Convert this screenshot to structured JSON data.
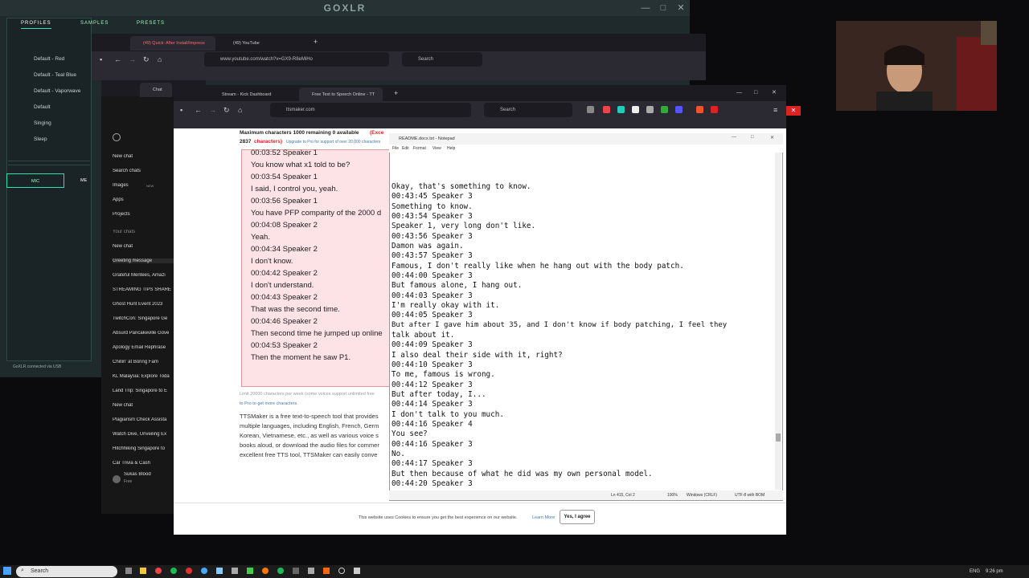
{
  "goxlr": {
    "title": "GOXLR",
    "tabs": [
      "PROFILES",
      "SAMPLES",
      "PRESETS"
    ],
    "profiles": [
      "Default - Red",
      "Default - Teal Blue",
      "Default - Vaporwave",
      "Default",
      "Singing",
      "Sleep"
    ],
    "bottom_tabs": [
      "MIC",
      "ME"
    ],
    "status": "GoXLR connected via USB",
    "accent_color": "#2ee0b0"
  },
  "browser1": {
    "tabs": [
      "(49) Quick: After Install/Impress",
      "(49) YouTube"
    ],
    "url": "www.youtube.com/watch?v=GX9-R8eMiHo",
    "search_placeholder": "Search"
  },
  "chat": {
    "tab_label": "Chat",
    "menu": [
      "New chat",
      "Search chats",
      "Images",
      "Apps",
      "Projects"
    ],
    "images_badge": "NEW",
    "section": "Your chats",
    "items": [
      "New chat",
      "Greeting message",
      "Grateful Mentees, Amazi",
      "STREAMING TIPS SHARE",
      "Ghost Hunt Event 2023",
      "TwitchCon: Singapore Ge",
      "Absurd Pancakeville Gove",
      "Apology Email Rephrase",
      "Chillin' at Boring Fam",
      "KL Malaysia: Explore Toda",
      "Land Trip: Singapore to E",
      "New chat",
      "Plagiarism Check Assista",
      "Watch Dive, Unveiling Ex",
      "Hitchhiking Singapore to",
      "Car Trivia & Cash"
    ],
    "user_name": "Sukas Blood",
    "user_plan": "Free"
  },
  "browser3": {
    "tabs": [
      "Stream - Kick Dashboard",
      "Free Text to Speech Online - TT"
    ],
    "url": "ttsmaker.com",
    "search_placeholder": "Search"
  },
  "tts": {
    "char_info": "Maximum characters 1000 remaining 0 available",
    "char_info_extra": "(Exce",
    "char_count": "2837",
    "char_count_suffix": "characters)",
    "upgrade_note": "Upgrade to Pro for support of over 20,000 characters",
    "lines": [
      "00:03:52 Speaker 1",
      "You know what x1 told to be?",
      "00:03:54 Speaker 1",
      "I said, I control you, yeah.",
      "00:03:56 Speaker 1",
      "You have PFP comparity of the 2000 d",
      "00:04:08 Speaker 2",
      "Yeah.",
      "00:04:34 Speaker 2",
      "I don't know.",
      "00:04:42 Speaker 2",
      "I don't understand.",
      "00:04:43 Speaker 2",
      "That was the second time.",
      "00:04:46 Speaker 2",
      "Then second time he jumped up online",
      "00:04:53 Speaker 2",
      "Then the moment he saw P1."
    ],
    "limit_note": "Limit 20000 characters per week (some voices support unlimited free",
    "pro_link": "to Pro to get more characters.",
    "description": [
      "TTSMaker is a free text-to-speech tool that provides",
      "multiple languages, including English, French, Germ",
      "Korean, Vietnamese, etc., as well as various voice s",
      "books aloud, or download the audio files for commer",
      "excellent free TTS tool, TTSMaker can easily conve"
    ],
    "cookie_text": "This website uses Cookies to ensure you get the best experience on our website.",
    "cookie_link": "Learn More",
    "cookie_button": "Yes, I agree"
  },
  "notepad": {
    "title": "README.docx.txt - Notepad",
    "menu": [
      "File",
      "Edit",
      "Format",
      "View",
      "Help"
    ],
    "lines": [
      "",
      "Okay, that's something to know.",
      "00:43:45 Speaker 3",
      "Something to know.",
      "00:43:54 Speaker 3",
      "Speaker 1, very long don't like.",
      "00:43:56 Speaker 3",
      "Damon was again.",
      "00:43:57 Speaker 3",
      "Famous, I don't really like when he hang out with the body patch.",
      "00:44:00 Speaker 3",
      "But famous alone, I hang out.",
      "00:44:03 Speaker 3",
      "I'm really okay with it.",
      "00:44:05 Speaker 3",
      "But after I gave him about 35, and I don't know if body patching, I feel they",
      "talk about it.",
      "00:44:09 Speaker 3",
      "I also deal their side with it, right?",
      "00:44:10 Speaker 3",
      "To me, famous is wrong.",
      "00:44:12 Speaker 3",
      "But after today, I...",
      "00:44:14 Speaker 3",
      "I don't talk to you much.",
      "00:44:16 Speaker 4",
      "You see?",
      "00:44:16 Speaker 3",
      "No.",
      "00:44:17 Speaker 3",
      "But then because of what he did was my own personal model.",
      "00:44:20 Speaker 3"
    ],
    "status_pos": "Ln 415, Col 2",
    "status_zoom": "100%",
    "status_eol": "Windows (CRLF)",
    "status_enc": "UTF-8 with BOM"
  },
  "taskbar": {
    "search_label": "Search",
    "lang": "ENG",
    "time": "9:26 pm"
  },
  "icons": [
    "windows-icon",
    "search-icon",
    "chrome-icon",
    "firefox-icon",
    "spotify-icon",
    "folder-icon"
  ]
}
